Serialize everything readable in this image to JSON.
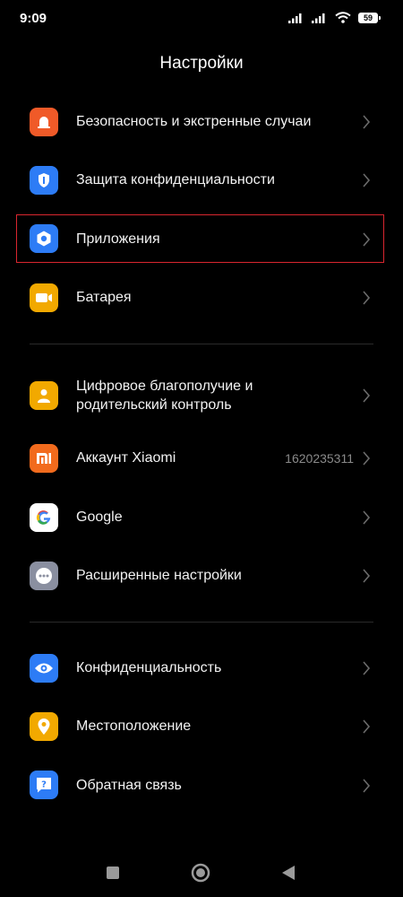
{
  "status_bar": {
    "time": "9:09",
    "battery": "59"
  },
  "header": {
    "title": "Настройки"
  },
  "settings": {
    "group1": [
      {
        "label": "Безопасность и экстренные случаи",
        "icon": "emergency-icon",
        "color": "#f05a28"
      },
      {
        "label": "Защита конфиденциальности",
        "icon": "privacy-shield-icon",
        "color": "#2d7cf6"
      },
      {
        "label": "Приложения",
        "icon": "apps-gear-icon",
        "color": "#2d7cf6",
        "highlighted": true
      },
      {
        "label": "Батарея",
        "icon": "battery-icon",
        "color": "#f2a900"
      }
    ],
    "group2": [
      {
        "label_line1": "Цифровое благополучие и",
        "label_line2": "родительский контроль",
        "icon": "wellbeing-icon",
        "color": "#f2a900"
      },
      {
        "label": "Аккаунт Xiaomi",
        "value": "1620235311",
        "icon": "xiaomi-icon",
        "color": "#f26b1d"
      },
      {
        "label": "Google",
        "icon": "google-icon",
        "color": "#ffffff"
      },
      {
        "label": "Расширенные настройки",
        "icon": "more-dots-icon",
        "color": "#8a8fa0"
      }
    ],
    "group3": [
      {
        "label": "Конфиденциальность",
        "icon": "eye-icon",
        "color": "#2d7cf6"
      },
      {
        "label": "Местоположение",
        "icon": "location-pin-icon",
        "color": "#f2a900"
      },
      {
        "label": "Обратная связь",
        "icon": "feedback-icon",
        "color": "#2d7cf6"
      }
    ]
  },
  "nav": {
    "icons": [
      "recents-square-icon",
      "home-circle-icon",
      "back-triangle-icon"
    ]
  },
  "colors": {
    "background": "#000000",
    "highlight_border": "#d9262f",
    "divider": "#2a2a2a",
    "chevron": "#6b6b6b"
  }
}
